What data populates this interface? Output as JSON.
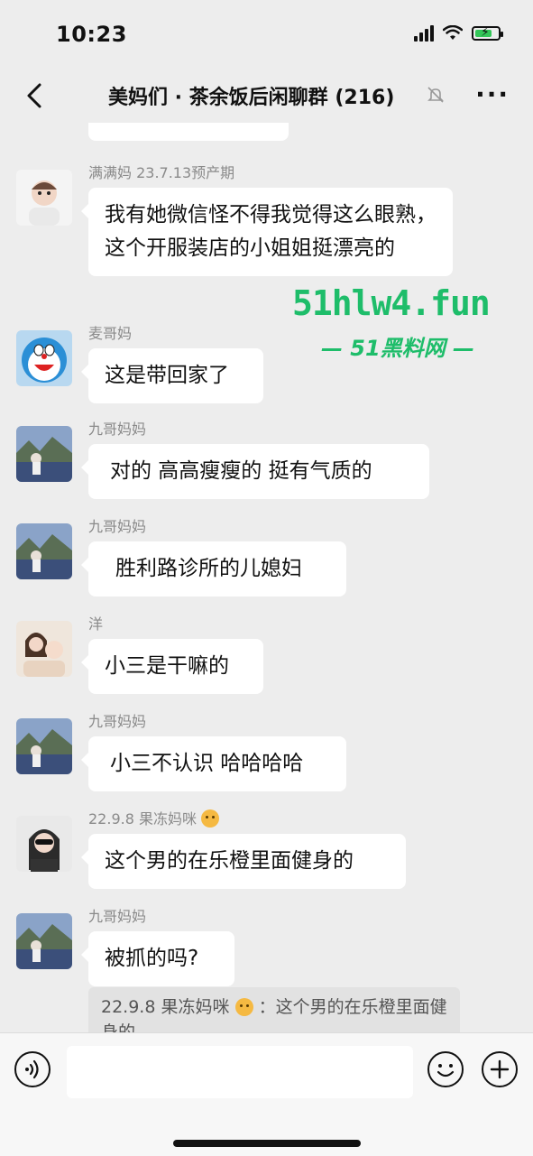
{
  "status_bar": {
    "time": "10:23",
    "signal_icon": "signal-icon",
    "wifi_icon": "wifi-icon",
    "battery_icon": "battery-icon",
    "battery_color": "#34c759",
    "battery_level": 0.75
  },
  "nav": {
    "back_icon": "chevron-left-icon",
    "title": "美妈们 · 茶余饭后闲聊群 (216)",
    "mute_icon": "bell-off-icon",
    "more_label": "···"
  },
  "messages": [
    {
      "sender": "满满妈 23.7.13预产期",
      "text": "我有她微信怪不得我觉得这么眼熟，这个开服装店的小姐姐挺漂亮的",
      "avatar": "baby-avatar"
    },
    {
      "sender": "麦哥妈",
      "text": "这是带回家了",
      "avatar": "doraemon-avatar"
    },
    {
      "sender": "九哥妈妈",
      "text": "对的 高高瘦瘦的 挺有气质的",
      "avatar": "landscape-avatar"
    },
    {
      "sender": "九哥妈妈",
      "text": "胜利路诊所的儿媳妇",
      "avatar": "landscape-avatar"
    },
    {
      "sender": "洋",
      "text": "小三是干嘛的",
      "avatar": "mother-child-avatar"
    },
    {
      "sender": "九哥妈妈",
      "text": "小三不认识 哈哈哈哈",
      "avatar": "landscape-avatar"
    },
    {
      "sender": "22.9.8 果冻妈咪",
      "text": "这个男的在乐橙里面健身的",
      "avatar": "woman-sunglasses-avatar"
    },
    {
      "sender": "九哥妈妈",
      "text": "被抓的吗?",
      "avatar": "landscape-avatar"
    }
  ],
  "quote": {
    "author": "22.9.8 果冻妈咪",
    "text": "：这个男的在乐橙里面健身的"
  },
  "watermark": {
    "url": "51hlw4.fun",
    "site": "— 51黑料网 —",
    "color": "#1ebd6a"
  },
  "input_bar": {
    "voice_icon": "voice-icon",
    "emoji_icon": "smiley-icon",
    "plus_icon": "plus-icon",
    "placeholder": ""
  }
}
